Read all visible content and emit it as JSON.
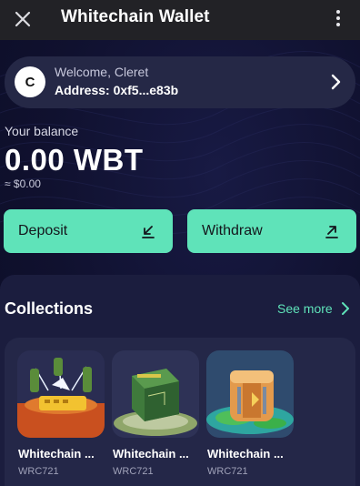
{
  "topbar": {
    "title": "Whitechain Wallet",
    "close_icon": "close-icon",
    "menu_icon": "kebab-menu-icon"
  },
  "account": {
    "avatar_letter": "C",
    "welcome": "Welcome, Cleret",
    "address": "Address: 0xf5...e83b",
    "chevron_icon": "chevron-right-icon"
  },
  "balance": {
    "label": "Your balance",
    "amount": "0.00 WBT",
    "fiat": "≈ $0.00"
  },
  "actions": {
    "deposit_label": "Deposit",
    "deposit_icon": "arrow-down-left-icon",
    "withdraw_label": "Withdraw",
    "withdraw_icon": "arrow-up-right-icon"
  },
  "collections": {
    "title": "Collections",
    "see_more": "See more",
    "items": [
      {
        "name": "Whitechain ...",
        "standard": "WRC721"
      },
      {
        "name": "Whitechain ...",
        "standard": "WRC721"
      },
      {
        "name": "Whitechain ...",
        "standard": "WRC721"
      }
    ]
  },
  "colors": {
    "accent": "#5fe3b9",
    "background": "#10112f",
    "topbar": "#222226",
    "card": "#252846",
    "panel": "#1b1d3e"
  }
}
